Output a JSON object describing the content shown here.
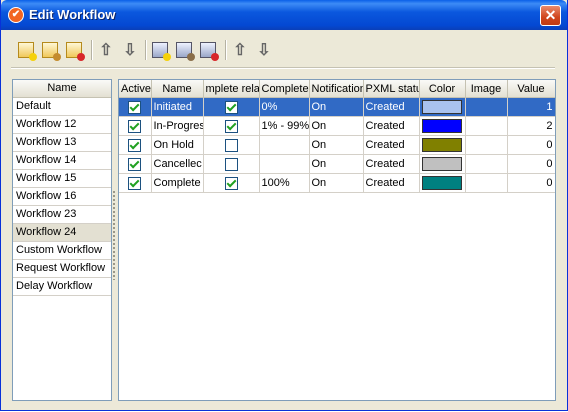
{
  "window": {
    "title": "Edit Workflow",
    "close_glyph": "✕"
  },
  "toolbar": {
    "buttons": [
      {
        "name": "new-workflow-button",
        "icon": "new-doc-icon"
      },
      {
        "name": "edit-workflow-button",
        "icon": "edit-doc-icon"
      },
      {
        "name": "delete-workflow-button",
        "icon": "delete-doc-icon"
      },
      {
        "name": "move-workflow-up-button",
        "icon": "arrow-up-icon",
        "glyph": "⇧"
      },
      {
        "name": "move-workflow-down-button",
        "icon": "arrow-down-icon",
        "glyph": "⇩"
      },
      {
        "name": "new-status-button",
        "icon": "new-status-icon"
      },
      {
        "name": "edit-status-button",
        "icon": "edit-status-icon"
      },
      {
        "name": "delete-status-button",
        "icon": "delete-status-icon"
      },
      {
        "name": "move-status-up-button",
        "icon": "arrow-up-icon",
        "glyph": "⇧"
      },
      {
        "name": "move-status-down-button",
        "icon": "arrow-down-icon",
        "glyph": "⇩"
      }
    ]
  },
  "workflow_list": {
    "header": "Name",
    "items": [
      "Default",
      "Workflow 12",
      "Workflow 13",
      "Workflow 14",
      "Workflow 15",
      "Workflow 16",
      "Workflow 23",
      "Workflow 24",
      "Custom Workflow",
      "Request Workflow",
      "Delay Workflow"
    ],
    "selected": "Workflow 24"
  },
  "status_grid": {
    "columns": [
      "Active",
      "Name",
      "mplete rela",
      "Complete",
      "Notification",
      "PXML statu",
      "Color",
      "Image",
      "Value"
    ],
    "rows": [
      {
        "active": true,
        "name": "Initiated",
        "complete_related": true,
        "complete": "0%",
        "notification": "On",
        "pxml_status": "Created",
        "color": "#a9c2ee",
        "image": "",
        "value": "1",
        "selected": true
      },
      {
        "active": true,
        "name": "In-Progres",
        "complete_related": true,
        "complete": "1% - 99%",
        "notification": "On",
        "pxml_status": "Created",
        "color": "#0000ff",
        "image": "",
        "value": "2",
        "selected": false
      },
      {
        "active": true,
        "name": "On Hold",
        "complete_related": false,
        "complete": "",
        "notification": "On",
        "pxml_status": "Created",
        "color": "#808000",
        "image": "",
        "value": "0",
        "selected": false
      },
      {
        "active": true,
        "name": "Cancellec",
        "complete_related": false,
        "complete": "",
        "notification": "On",
        "pxml_status": "Created",
        "color": "#c0c0c0",
        "image": "",
        "value": "0",
        "selected": false
      },
      {
        "active": true,
        "name": "Complete",
        "complete_related": true,
        "complete": "100%",
        "notification": "On",
        "pxml_status": "Created",
        "color": "#008080",
        "image": "",
        "value": "0",
        "selected": false
      }
    ]
  }
}
